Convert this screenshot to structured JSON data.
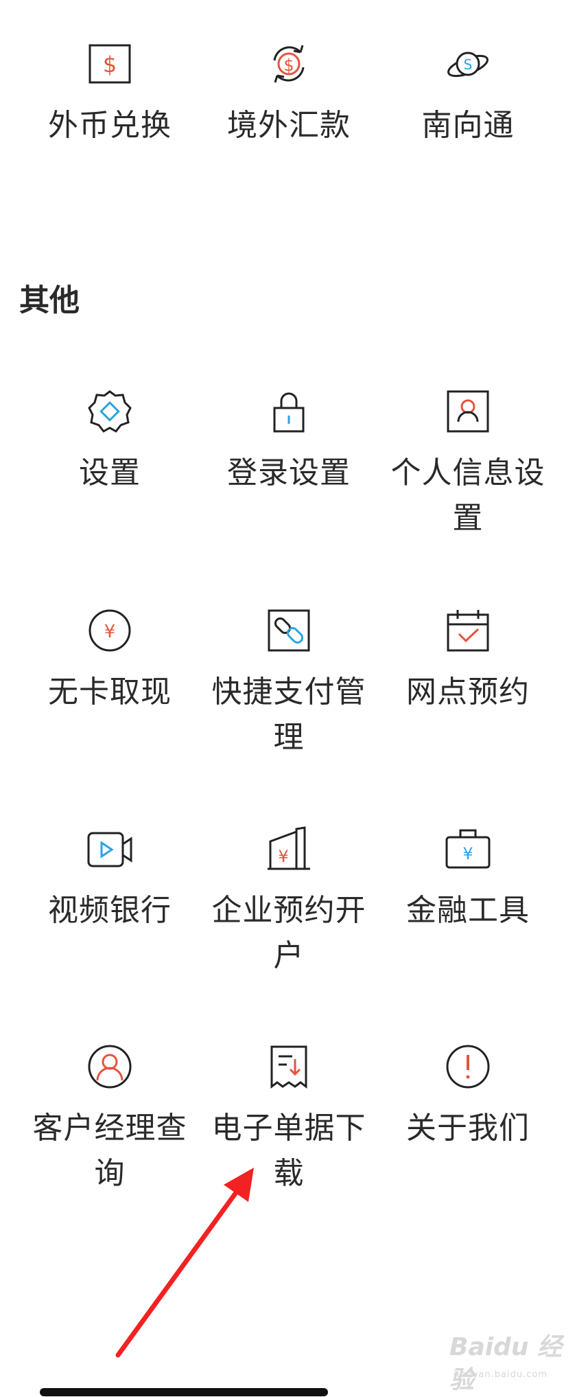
{
  "colors": {
    "accent_red": "#e5533d",
    "accent_blue": "#2aa3e0",
    "stroke": "#222222"
  },
  "top_row": [
    {
      "label": "外币兑换",
      "icon": "dollar-square-icon"
    },
    {
      "label": "境外汇款",
      "icon": "dollar-refresh-icon"
    },
    {
      "label": "南向通",
      "icon": "planet-icon"
    }
  ],
  "section": {
    "title": "其他"
  },
  "others": [
    {
      "label": "设置",
      "icon": "gear-icon"
    },
    {
      "label": "登录设置",
      "icon": "lock-icon"
    },
    {
      "label": "个人信息设置",
      "icon": "profile-card-icon"
    },
    {
      "label": "无卡取现",
      "icon": "yuan-circle-icon"
    },
    {
      "label": "快捷支付管理",
      "icon": "link-square-icon"
    },
    {
      "label": "网点预约",
      "icon": "calendar-check-icon"
    },
    {
      "label": "视频银行",
      "icon": "video-camera-icon"
    },
    {
      "label": "企业预约开户",
      "icon": "building-yuan-icon"
    },
    {
      "label": "金融工具",
      "icon": "briefcase-yuan-icon"
    },
    {
      "label": "客户经理查询",
      "icon": "user-circle-icon"
    },
    {
      "label": "电子单据下载",
      "icon": "receipt-download-icon"
    },
    {
      "label": "关于我们",
      "icon": "info-circle-icon"
    }
  ],
  "watermark": {
    "main": "Baidu 经验",
    "sub": "jingyan.baidu.com"
  }
}
